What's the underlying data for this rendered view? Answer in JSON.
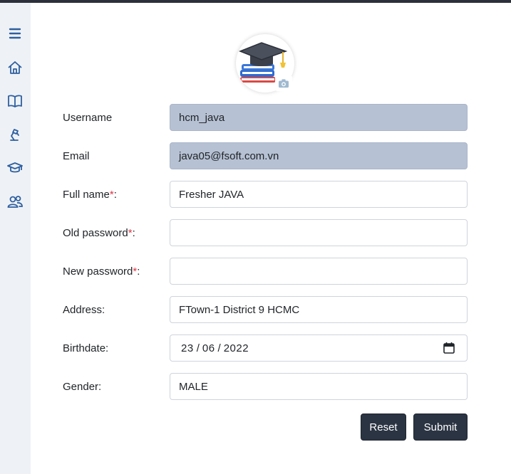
{
  "colors": {
    "topbar": "#2b303b",
    "sidebar_bg": "#eef2f7",
    "sidebar_icon": "#2f5f9e",
    "disabled_field_bg": "#b6c1d3",
    "required_star": "#dc3545",
    "button_bg": "#2b3443"
  },
  "sidebar": {
    "items": [
      {
        "icon": "menu-icon"
      },
      {
        "icon": "home-icon"
      },
      {
        "icon": "book-open-icon"
      },
      {
        "icon": "desk-lamp-icon"
      },
      {
        "icon": "graduation-cap-icon"
      },
      {
        "icon": "users-icon"
      }
    ]
  },
  "avatar": {
    "icon": "graduation-cap-books-logo",
    "upload_icon": "camera-icon"
  },
  "form": {
    "username": {
      "label": "Username",
      "value": "hcm_java"
    },
    "email": {
      "label": "Email",
      "value": "java05@fsoft.com.vn"
    },
    "full_name": {
      "label": "Full name",
      "required_mark": "*",
      "suffix": ":",
      "value": "Fresher JAVA"
    },
    "old_password": {
      "label": "Old password",
      "required_mark": "*",
      "suffix": ":",
      "value": ""
    },
    "new_password": {
      "label": "New password",
      "required_mark": "*",
      "suffix": ":",
      "value": ""
    },
    "address": {
      "label": "Address:",
      "value": "FTown-1 District 9 HCMC"
    },
    "birthdate": {
      "label": "Birthdate:",
      "day": "23",
      "month": "06",
      "year": "2022",
      "separator": "/"
    },
    "gender": {
      "label": "Gender:",
      "value": "MALE"
    }
  },
  "buttons": {
    "reset": "Reset",
    "submit": "Submit"
  }
}
